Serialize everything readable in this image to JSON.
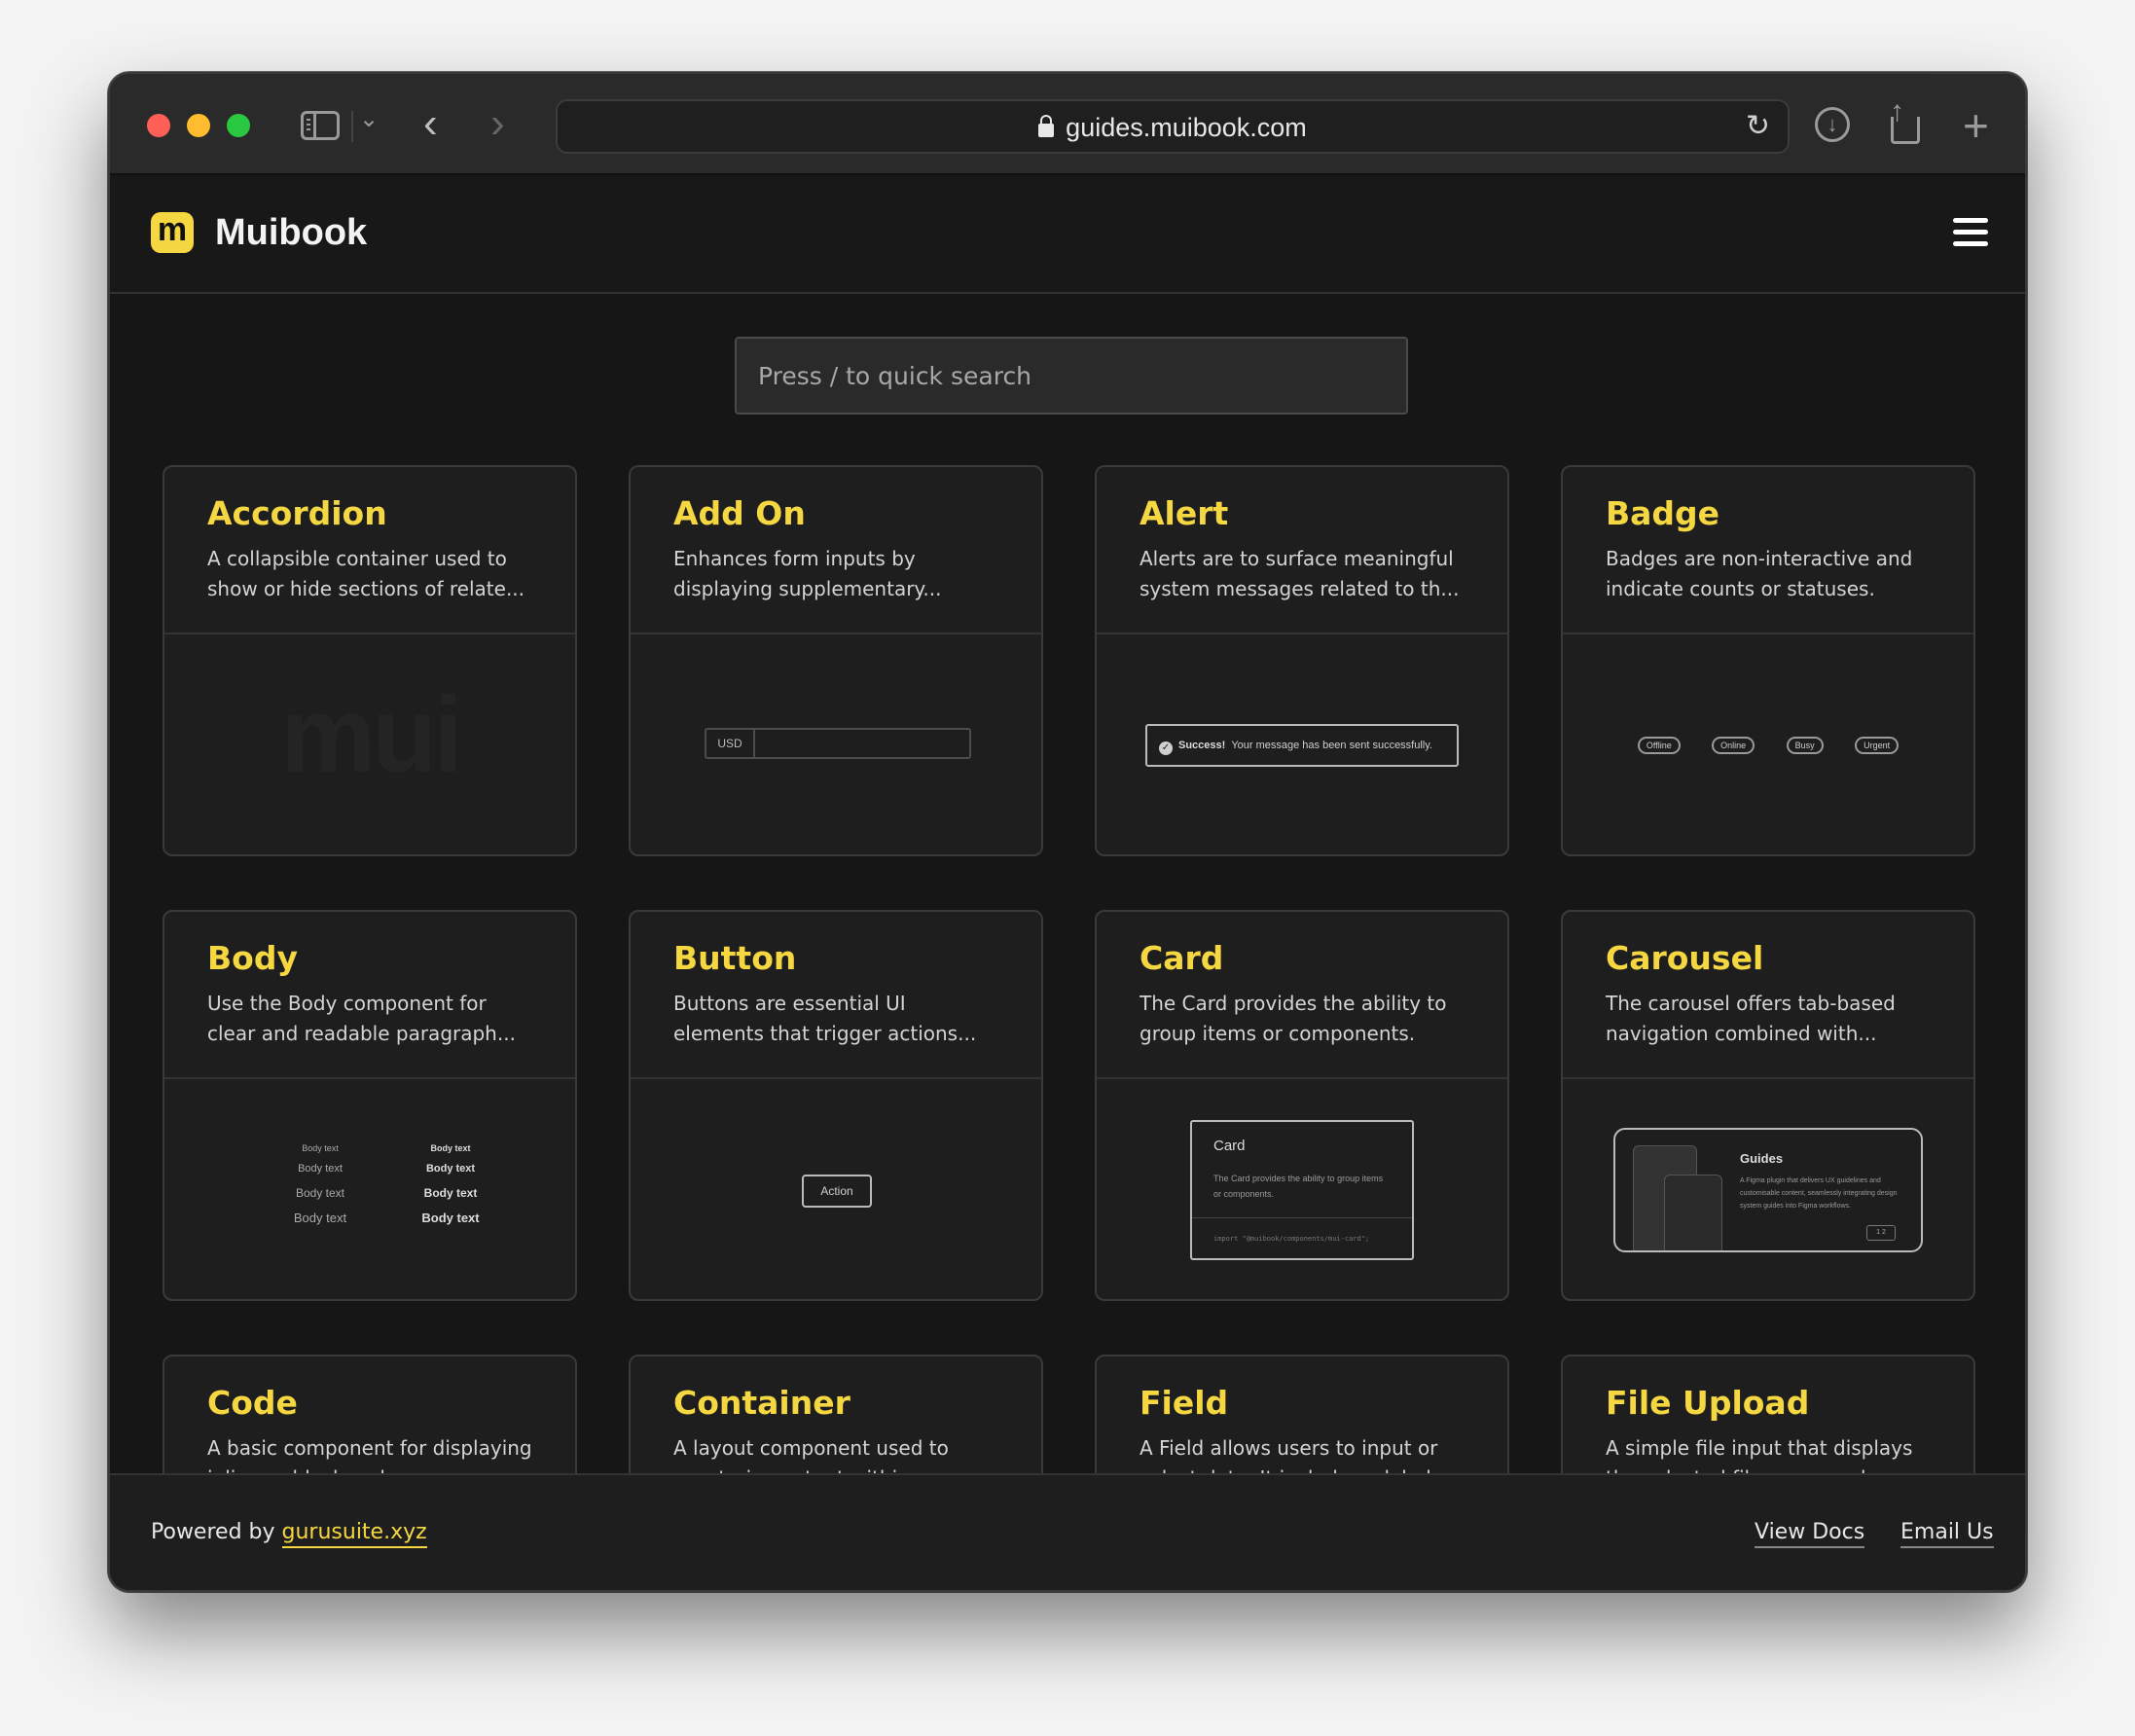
{
  "browser": {
    "url": "guides.muibook.com"
  },
  "header": {
    "logo_letter": "m",
    "brand": "Muibook"
  },
  "search": {
    "placeholder": "Press / to quick search"
  },
  "cards": [
    {
      "title": "Accordion",
      "desc": "A collapsible container used to show or hide sections of relate..."
    },
    {
      "title": "Add On",
      "desc": "Enhances form inputs by displaying supplementary..."
    },
    {
      "title": "Alert",
      "desc": "Alerts are to surface meaningful system messages related to th..."
    },
    {
      "title": "Badge",
      "desc": "Badges are non-interactive and indicate counts or statuses."
    },
    {
      "title": "Body",
      "desc": "Use the Body component for clear and readable paragraph..."
    },
    {
      "title": "Button",
      "desc": "Buttons are essential UI elements that trigger actions..."
    },
    {
      "title": "Card",
      "desc": "The Card provides the ability to group items or components."
    },
    {
      "title": "Carousel",
      "desc": "The carousel offers tab-based navigation combined with..."
    },
    {
      "title": "Code",
      "desc": "A basic component for displaying inline or block code..."
    },
    {
      "title": "Container",
      "desc": "A layout component used to constrain content within a..."
    },
    {
      "title": "Field",
      "desc": "A Field allows users to input or select data. It includes a label..."
    },
    {
      "title": "File Upload",
      "desc": "A simple file input that displays the selected file name and emit..."
    }
  ],
  "previews": {
    "accordion_watermark": "mui",
    "addon_prefix": "USD",
    "alert_title": "Success!",
    "alert_message": "Your message has been sent successfully.",
    "badges": [
      "Offline",
      "Online",
      "Busy",
      "Urgent"
    ],
    "body_text": "Body text",
    "button_label": "Action",
    "card_title": "Card",
    "card_desc": "The Card provides the ability to group items or components.",
    "card_code": "import \"@muibook/components/mui-card\";",
    "carousel_title": "Guides",
    "carousel_desc": "A Figma plugin that delivers UX guidelines and customisable content, seamlessly integrating design system guides into Figma workflows.",
    "carousel_nav": "1  2"
  },
  "footer": {
    "powered_prefix": "Powered by",
    "powered_link": "gurusuite.xyz",
    "link_docs": "View Docs",
    "link_email": "Email Us"
  },
  "icons": {
    "lock": "lock-icon",
    "reload": "reload-icon",
    "download": "download-icon",
    "share": "share-icon",
    "new_tab": "plus-icon",
    "menu": "hamburger-icon"
  }
}
